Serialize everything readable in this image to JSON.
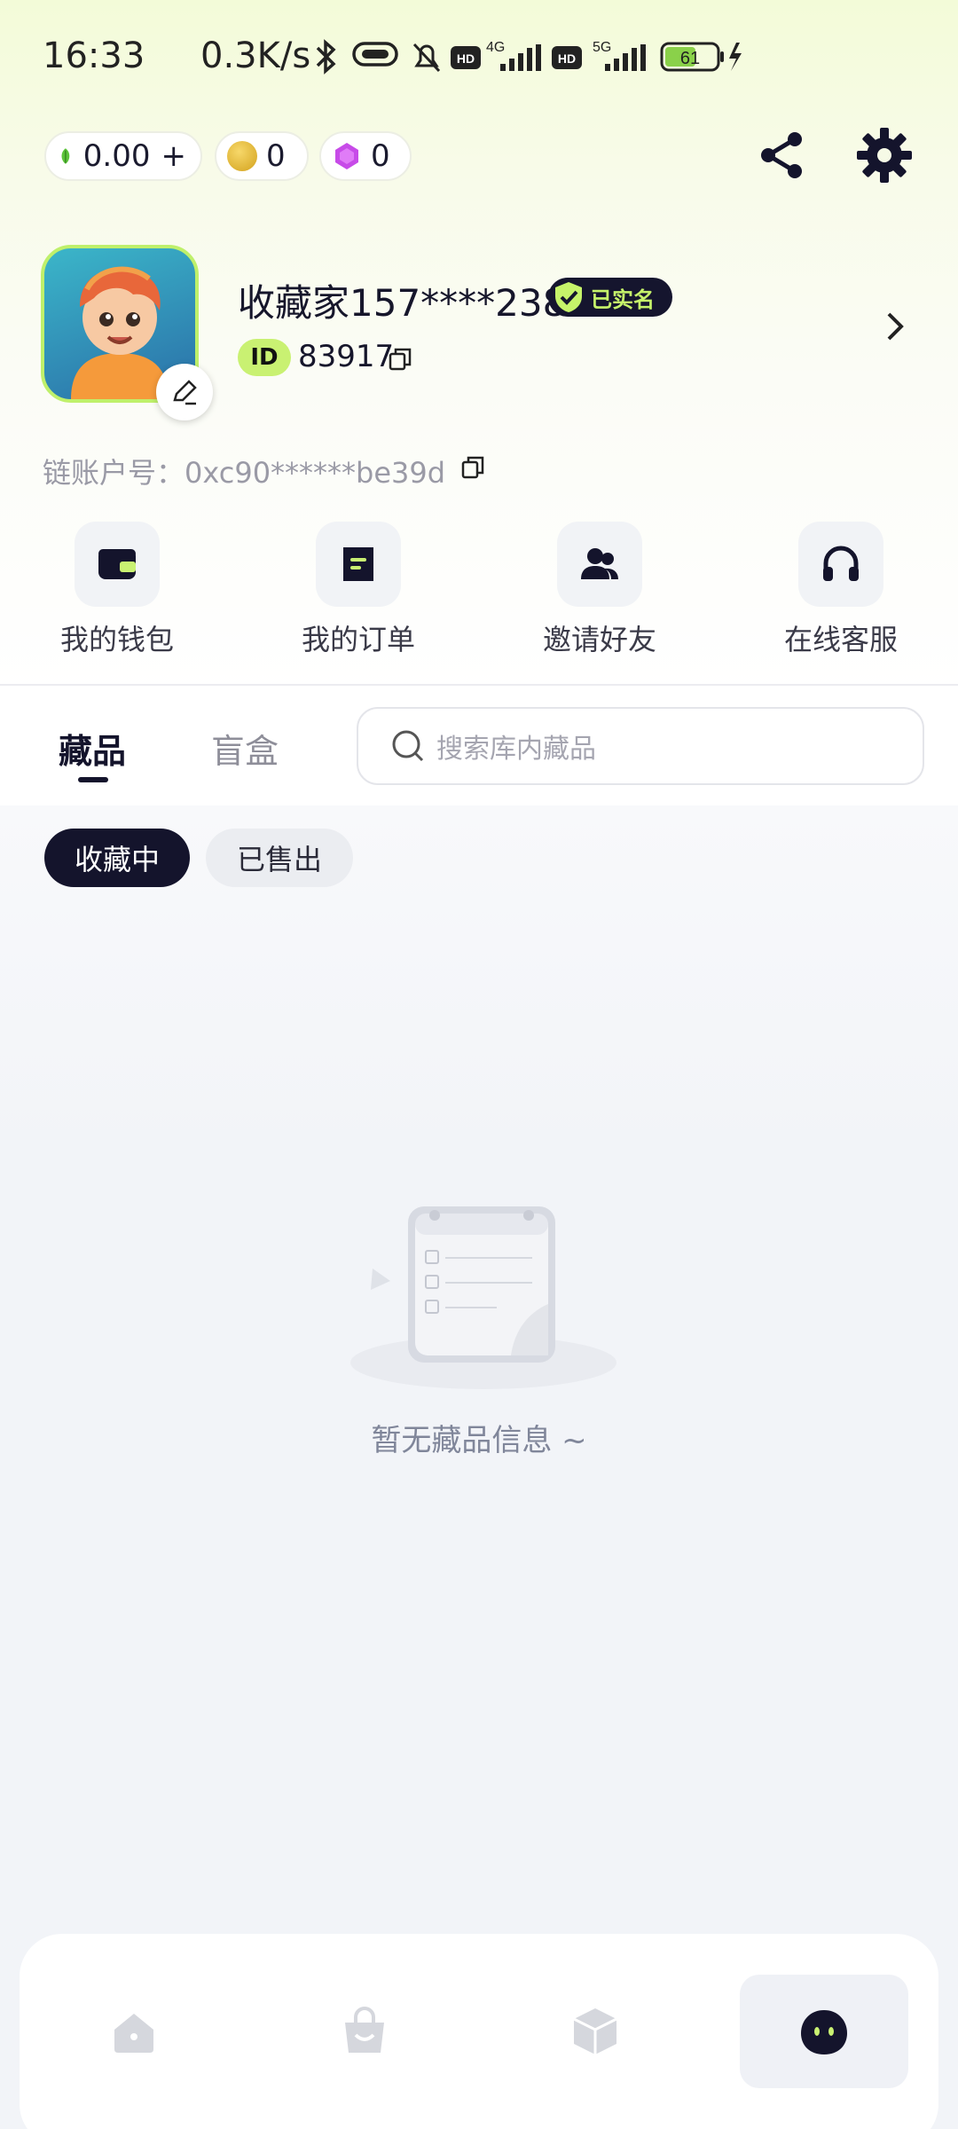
{
  "status_bar": {
    "time": "16:33",
    "speed": "0.3K/s",
    "network_1": "4G",
    "network_2": "5G",
    "battery": "61",
    "hd_label": "HD"
  },
  "currency": {
    "green_balance": "0.00",
    "green_add": "+",
    "coin_balance": "0",
    "gem_balance": "0"
  },
  "profile": {
    "username": "收藏家157****2385",
    "verified_label": "已实名",
    "id_label": "ID",
    "id_value": "83917",
    "chain_account": "链账户号：0xc90******be39d"
  },
  "quick_actions": [
    {
      "label": "我的钱包",
      "icon": "wallet-icon"
    },
    {
      "label": "我的订单",
      "icon": "order-icon"
    },
    {
      "label": "邀请好友",
      "icon": "invite-friends-icon"
    },
    {
      "label": "在线客服",
      "icon": "headset-icon"
    }
  ],
  "tabs": [
    {
      "label": "藏品",
      "active": true
    },
    {
      "label": "盲盒",
      "active": false
    }
  ],
  "search": {
    "placeholder": "搜索库内藏品"
  },
  "filters": [
    {
      "label": "收藏中",
      "active": true
    },
    {
      "label": "已售出",
      "active": false
    }
  ],
  "empty_state": {
    "text": "暂无藏品信息 ~"
  },
  "bottom_nav": [
    {
      "icon": "home-icon",
      "active": false
    },
    {
      "icon": "shopping-bag-icon",
      "active": false
    },
    {
      "icon": "box-icon",
      "active": false
    },
    {
      "icon": "profile-mascot-icon",
      "active": true
    }
  ],
  "colors": {
    "accent_lime": "#c9f172",
    "dark_navy": "#14142c",
    "background": "#f2f4f8"
  }
}
